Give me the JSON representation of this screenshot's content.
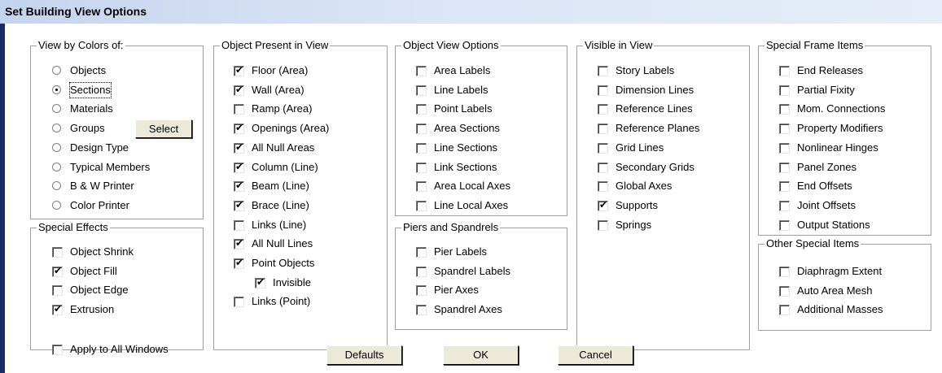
{
  "window": {
    "title": "Set Building View Options"
  },
  "view_by_colors": {
    "title": "View by Colors of:",
    "items": [
      {
        "label": "Objects",
        "checked": false
      },
      {
        "label": "Sections",
        "checked": true
      },
      {
        "label": "Materials",
        "checked": false
      },
      {
        "label": "Groups",
        "checked": false
      },
      {
        "label": "Design Type",
        "checked": false
      },
      {
        "label": "Typical Members",
        "checked": false
      },
      {
        "label": "B & W Printer",
        "checked": false
      },
      {
        "label": "Color Printer",
        "checked": false
      }
    ],
    "select_button": "Select"
  },
  "special_effects": {
    "title": "Special Effects",
    "items": [
      {
        "label": "Object Shrink",
        "checked": false
      },
      {
        "label": "Object Fill",
        "checked": true
      },
      {
        "label": "Object Edge",
        "checked": false
      },
      {
        "label": "Extrusion",
        "checked": true
      }
    ]
  },
  "object_present": {
    "title": "Object Present in View",
    "items": [
      {
        "label": "Floor (Area)",
        "checked": true
      },
      {
        "label": "Wall (Area)",
        "checked": true
      },
      {
        "label": "Ramp (Area)",
        "checked": false
      },
      {
        "label": "Openings (Area)",
        "checked": true
      },
      {
        "label": "All Null Areas",
        "checked": true
      },
      {
        "label": "Column (Line)",
        "checked": true
      },
      {
        "label": "Beam (Line)",
        "checked": true
      },
      {
        "label": "Brace (Line)",
        "checked": true
      },
      {
        "label": "Links (Line)",
        "checked": false
      },
      {
        "label": "All Null Lines",
        "checked": true
      },
      {
        "label": "Point Objects",
        "checked": true
      },
      {
        "label": "Invisible",
        "checked": true
      },
      {
        "label": "Links (Point)",
        "checked": false
      }
    ]
  },
  "object_view": {
    "title": "Object View Options",
    "items": [
      {
        "label": "Area Labels",
        "checked": false
      },
      {
        "label": "Line Labels",
        "checked": false
      },
      {
        "label": "Point Labels",
        "checked": false
      },
      {
        "label": "Area Sections",
        "checked": false
      },
      {
        "label": "Line Sections",
        "checked": false
      },
      {
        "label": "Link Sections",
        "checked": false
      },
      {
        "label": "Area Local Axes",
        "checked": false
      },
      {
        "label": "Line Local Axes",
        "checked": false
      }
    ]
  },
  "piers_spandrels": {
    "title": "Piers and Spandrels",
    "items": [
      {
        "label": "Pier Labels",
        "checked": false
      },
      {
        "label": "Spandrel Labels",
        "checked": false
      },
      {
        "label": "Pier Axes",
        "checked": false
      },
      {
        "label": "Spandrel Axes",
        "checked": false
      }
    ]
  },
  "visible": {
    "title": "Visible in View",
    "items": [
      {
        "label": "Story Labels",
        "checked": false
      },
      {
        "label": "Dimension Lines",
        "checked": false
      },
      {
        "label": "Reference Lines",
        "checked": false
      },
      {
        "label": "Reference Planes",
        "checked": false
      },
      {
        "label": "Grid Lines",
        "checked": false
      },
      {
        "label": "Secondary Grids",
        "checked": false
      },
      {
        "label": "Global Axes",
        "checked": false
      },
      {
        "label": "Supports",
        "checked": true
      },
      {
        "label": "Springs",
        "checked": false
      }
    ]
  },
  "special_frame": {
    "title": "Special Frame Items",
    "items": [
      {
        "label": "End Releases",
        "checked": false
      },
      {
        "label": "Partial Fixity",
        "checked": false
      },
      {
        "label": "Mom. Connections",
        "checked": false
      },
      {
        "label": "Property Modifiers",
        "checked": false
      },
      {
        "label": "Nonlinear Hinges",
        "checked": false
      },
      {
        "label": "Panel Zones",
        "checked": false
      },
      {
        "label": "End Offsets",
        "checked": false
      },
      {
        "label": "Joint Offsets",
        "checked": false
      },
      {
        "label": "Output Stations",
        "checked": false
      }
    ]
  },
  "other_special": {
    "title": "Other Special Items",
    "items": [
      {
        "label": "Diaphragm Extent",
        "checked": false
      },
      {
        "label": "Auto Area Mesh",
        "checked": false
      },
      {
        "label": "Additional Masses",
        "checked": false
      }
    ]
  },
  "apply_all": {
    "label": "Apply to All Windows",
    "checked": false
  },
  "buttons": {
    "defaults": "Defaults",
    "ok": "OK",
    "cancel": "Cancel"
  }
}
